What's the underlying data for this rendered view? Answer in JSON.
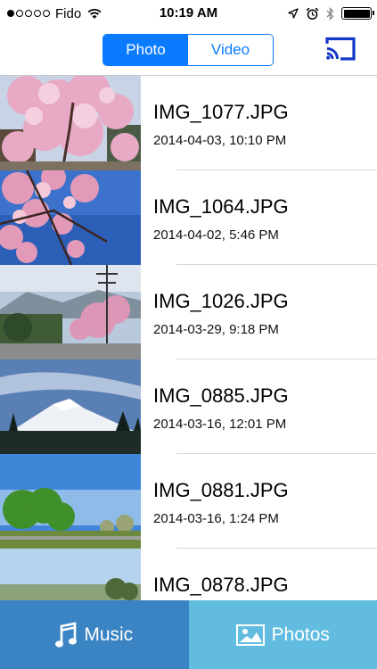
{
  "status_bar": {
    "carrier": "Fido",
    "time": "10:19 AM",
    "signal_bars_filled": 1,
    "signal_bars_total": 5,
    "battery_level": 1.0,
    "icons": [
      "wifi-icon",
      "location-arrow-icon",
      "alarm-icon",
      "bluetooth-icon",
      "battery-icon"
    ]
  },
  "nav": {
    "segments": [
      {
        "label": "Photo",
        "selected": true
      },
      {
        "label": "Video",
        "selected": false
      }
    ],
    "cast_icon": "cast-icon"
  },
  "photos": [
    {
      "name": "IMG_1077.JPG",
      "date": "2014-04-03, 10:10 PM"
    },
    {
      "name": "IMG_1064.JPG",
      "date": "2014-04-02, 5:46 PM"
    },
    {
      "name": "IMG_1026.JPG",
      "date": "2014-03-29, 9:18 PM"
    },
    {
      "name": "IMG_0885.JPG",
      "date": "2014-03-16, 12:01 PM"
    },
    {
      "name": "IMG_0881.JPG",
      "date": "2014-03-16, 1:24 PM"
    },
    {
      "name": "IMG_0878.JPG",
      "date": ""
    }
  ],
  "tabs": [
    {
      "label": "Music",
      "icon": "music-note-icon"
    },
    {
      "label": "Photos",
      "icon": "photo-icon"
    }
  ],
  "colors": {
    "accent": "#0a7aff",
    "tab_music": "#3b84c4",
    "tab_photos": "#61bce0"
  }
}
